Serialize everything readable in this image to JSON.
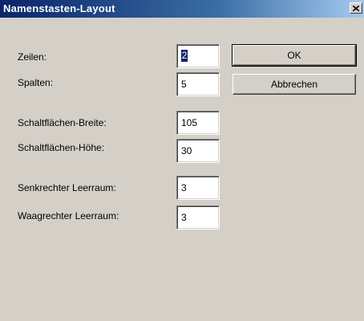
{
  "window": {
    "title": "Namenstasten-Layout"
  },
  "fields": [
    {
      "label": "Zeilen:",
      "value": "2",
      "selected": true
    },
    {
      "label": "Spalten:",
      "value": "5"
    },
    {
      "label": "Schaltflächen-Breite:",
      "value": "105"
    },
    {
      "label": "Schaltflächen-Höhe:",
      "value": "30"
    },
    {
      "label": "Senkrechter Leerraum:",
      "value": "3"
    },
    {
      "label": "Waagrechter Leerraum:",
      "value": "3"
    }
  ],
  "buttons": {
    "ok_label": "OK",
    "cancel_label": "Abbrechen"
  },
  "icons": {
    "close": "close-icon"
  },
  "colors": {
    "titlebar_start": "#0a246a",
    "titlebar_end": "#a6caf0",
    "dialog_bg": "#d4d0c8",
    "selection": "#0a246a"
  }
}
